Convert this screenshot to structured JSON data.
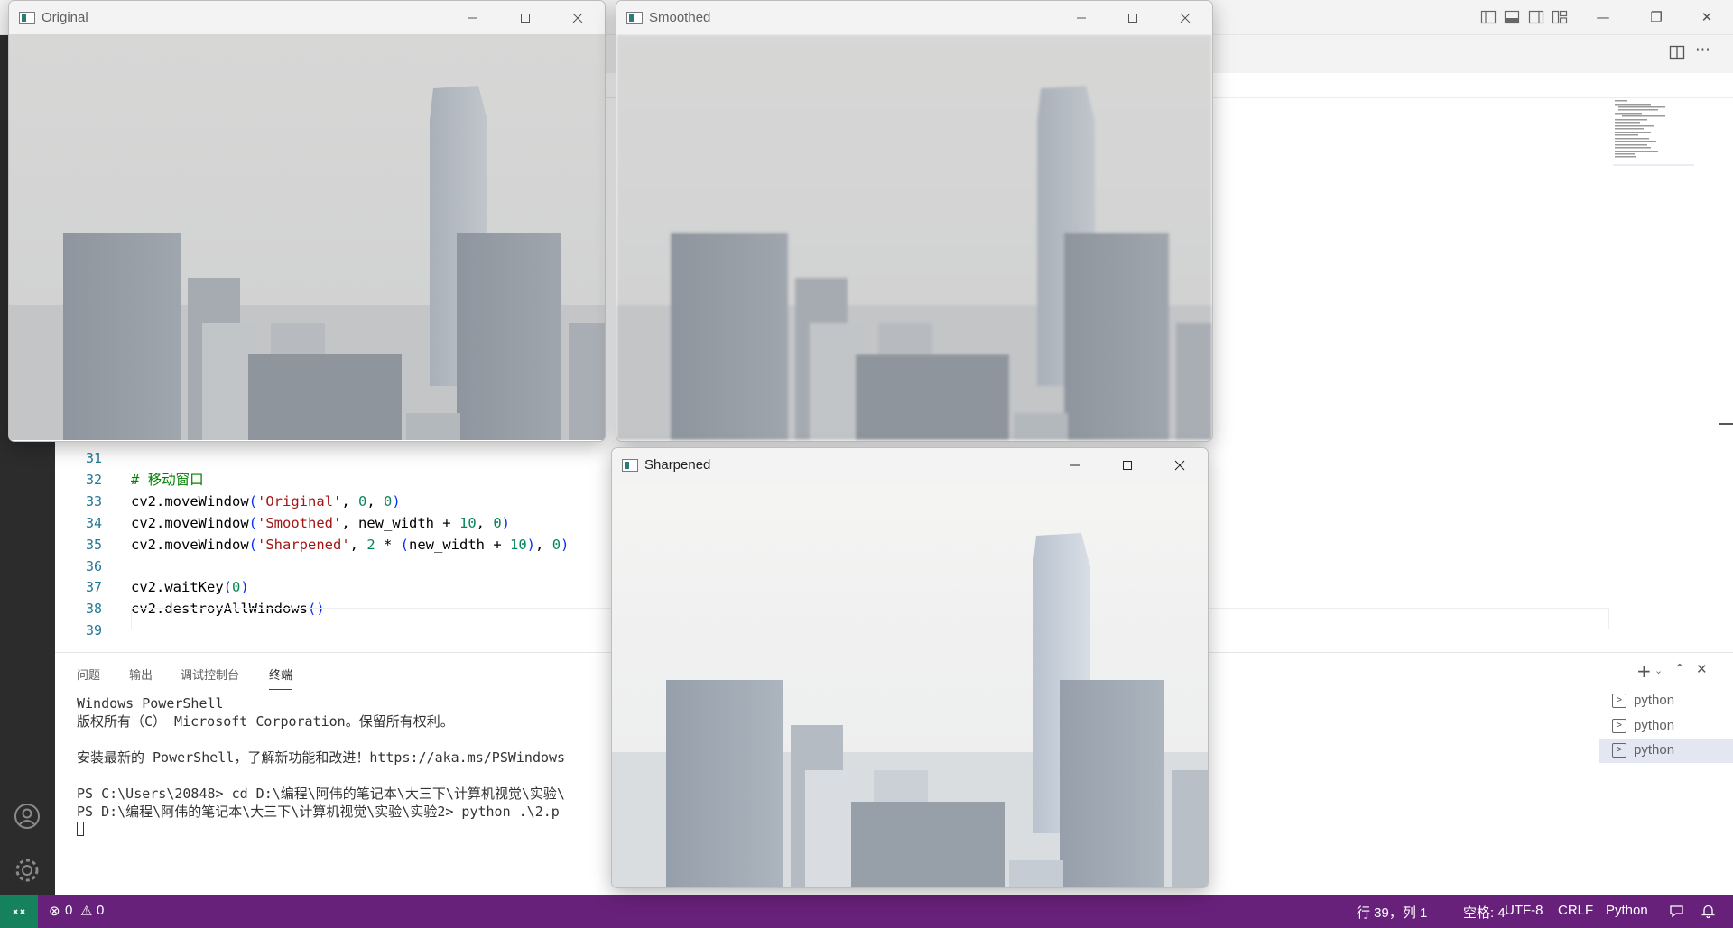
{
  "vscode": {
    "title_controls": [
      "toggle-primary-sidebar",
      "toggle-panel",
      "toggle-secondary-sidebar",
      "customize-layout"
    ],
    "editor_lines": [
      {
        "num": "31",
        "code": ""
      },
      {
        "num": "32",
        "code": "# 移动窗口"
      },
      {
        "num": "33",
        "code": "cv2.moveWindow('Original', 0, 0)"
      },
      {
        "num": "34",
        "code": "cv2.moveWindow('Smoothed', new_width + 10, 0)"
      },
      {
        "num": "35",
        "code": "cv2.moveWindow('Sharpened', 2 * (new_width + 10), 0)"
      },
      {
        "num": "36",
        "code": ""
      },
      {
        "num": "37",
        "code": "cv2.waitKey(0)"
      },
      {
        "num": "38",
        "code": "cv2.destroyAllWindows()"
      },
      {
        "num": "39",
        "code": ""
      }
    ],
    "panel": {
      "tabs": [
        "问题",
        "输出",
        "调试控制台",
        "终端"
      ],
      "active_tab": "终端",
      "terminal_lines": [
        "Windows PowerShell",
        "版权所有（C） Microsoft Corporation。保留所有权利。",
        "",
        "安装最新的 PowerShell，了解新功能和改进！https://aka.ms/PSWindows",
        "",
        "PS C:\\Users\\20848> cd D:\\编程\\阿伟的笔记本\\大三下\\计算机视觉\\实验\\",
        "PS D:\\编程\\阿伟的笔记本\\大三下\\计算机视觉\\实验\\实验2> python .\\2.p"
      ],
      "terminals": [
        {
          "label": "python",
          "selected": false
        },
        {
          "label": "python",
          "selected": false
        },
        {
          "label": "python",
          "selected": true
        }
      ]
    },
    "status_bar": {
      "errors": "0",
      "warnings": "0",
      "position": "行 39，列 1",
      "spaces": "空格: 4",
      "encoding": "UTF-8",
      "eol": "CRLF",
      "language": "Python",
      "color": "#68217a",
      "remote_color": "#16825d"
    }
  },
  "windows": [
    {
      "title": "Original"
    },
    {
      "title": "Smoothed"
    },
    {
      "title": "Sharpened"
    }
  ]
}
